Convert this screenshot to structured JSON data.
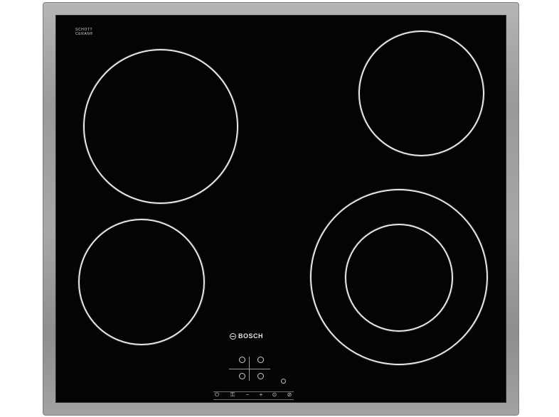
{
  "product": {
    "glass_brand_line1": "SCHOTT",
    "glass_brand_line2": "CERAN®",
    "glass_sub": "",
    "brand": "BOSCH"
  },
  "controls": {
    "power_label": "⏻",
    "minus_label": "−",
    "plus_label": "+",
    "lock_label": "⊙",
    "timer_label": "⊘"
  },
  "colors": {
    "glass": "#040404",
    "frame": "stainless steel",
    "zone_ring": "#e8e8e8"
  }
}
